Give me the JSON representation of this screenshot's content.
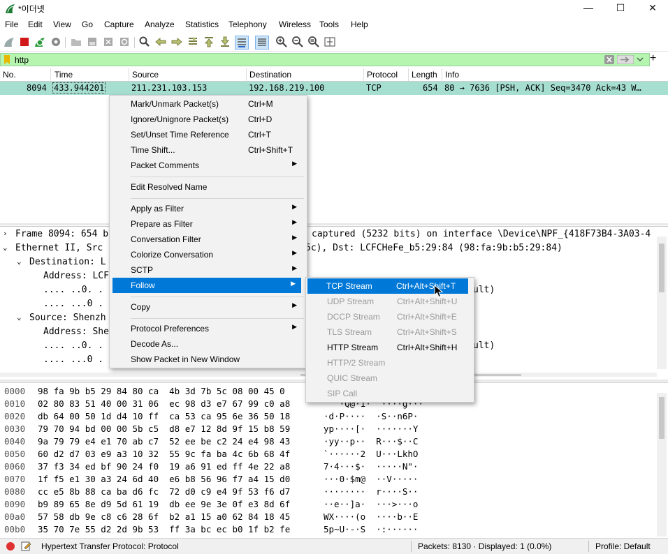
{
  "window": {
    "title": "*이더넷",
    "min_glyph": "—",
    "max_glyph": "☐",
    "close_glyph": "✕"
  },
  "menubar": [
    "File",
    "Edit",
    "View",
    "Go",
    "Capture",
    "Analyze",
    "Statistics",
    "Telephony",
    "Wireless",
    "Tools",
    "Help"
  ],
  "filter": {
    "value": "http"
  },
  "columns": [
    "No.",
    "Time",
    "Source",
    "Destination",
    "Protocol",
    "Length",
    "Info"
  ],
  "packet": {
    "no": "8094",
    "time": "433.944201",
    "source": "211.231.103.153",
    "destination": "192.168.219.100",
    "protocol": "TCP",
    "length": "654",
    "info": "80 → 7636 [PSH, ACK] Seq=3470 Ack=43 W…"
  },
  "details": {
    "frame": "Frame 8094: 654 b",
    "frame_right": "captured (5232 bits) on interface \\Device\\NPF_{418F73B4-3A03-4",
    "eth": "Ethernet II, Src",
    "eth_right": "5c), Dst: LCFCHeFe_b5:29:84 (98:fa:9b:b5:29:84)",
    "dst": "Destination: L",
    "dst_addr": "Address: LCF",
    "bit1": ".... ..0. .",
    "bit1_right": "ult)",
    "bit2": ".... ...0 .",
    "src": "Source: Shenzh",
    "src_addr": "Address: She",
    "bit3": ".... ..0. .",
    "bit3_right": "ult)",
    "bit4": ".... ...0 ."
  },
  "hex_rows": [
    {
      "off": "0000",
      "hex": "98 fa 9b b5 29 84 80 ca  4b 3d 7b 5c 08 00 45 0",
      "asc": ""
    },
    {
      "off": "0010",
      "hex": "02 80 83 51 40 00 31 06  ec 98 d3 e7 67 99 c0 a8",
      "asc": "   ·Q@·1·  ····g···"
    },
    {
      "off": "0020",
      "hex": "db 64 00 50 1d d4 10 ff  ca 53 ca 95 6e 36 50 18",
      "asc": "·d·P····  ·S··n6P·"
    },
    {
      "off": "0030",
      "hex": "79 70 94 bd 00 00 5b c5  d8 e7 12 8d 9f 15 b8 59",
      "asc": "yp····[·  ·······Y"
    },
    {
      "off": "0040",
      "hex": "9a 79 79 e4 e1 70 ab c7  52 ee be c2 24 e4 98 43",
      "asc": "·yy··p··  R···$··C"
    },
    {
      "off": "0050",
      "hex": "60 d2 d7 03 e9 a3 10 32  55 9c fa ba 4c 6b 68 4f",
      "asc": "`······2  U···LkhO"
    },
    {
      "off": "0060",
      "hex": "37 f3 34 ed bf 90 24 f0  19 a6 91 ed ff 4e 22 a8",
      "asc": "7·4···$·  ·····N\"·"
    },
    {
      "off": "0070",
      "hex": "1f f5 e1 30 a3 24 6d 40  e6 b8 56 96 f7 a4 15 d0",
      "asc": "···0·$m@  ··V·····"
    },
    {
      "off": "0080",
      "hex": "cc e5 8b 88 ca ba d6 fc  72 d0 c9 e4 9f 53 f6 d7",
      "asc": "········  r····S··"
    },
    {
      "off": "0090",
      "hex": "b9 89 65 8e d9 5d 61 19  db ee 9e 3e 0f e3 8d 6f",
      "asc": "··e··]a·  ···>···o"
    },
    {
      "off": "00a0",
      "hex": "57 58 db 9e c8 c6 28 6f  b2 a1 15 a0 62 84 18 45",
      "asc": "WX····(o  ····b··E"
    },
    {
      "off": "00b0",
      "hex": "35 70 7e 55 d2 2d 9b 53  ff 3a bc ec b0 1f b2 fe",
      "asc": "5p~U·-·S  ·:······"
    }
  ],
  "context_menu": [
    {
      "label": "Mark/Unmark Packet(s)",
      "shortcut": "Ctrl+M"
    },
    {
      "label": "Ignore/Unignore Packet(s)",
      "shortcut": "Ctrl+D"
    },
    {
      "label": "Set/Unset Time Reference",
      "shortcut": "Ctrl+T"
    },
    {
      "label": "Time Shift...",
      "shortcut": "Ctrl+Shift+T"
    },
    {
      "label": "Packet Comments",
      "shortcut": ""
    },
    {
      "label": "Edit Resolved Name",
      "shortcut": ""
    },
    {
      "label": "Apply as Filter",
      "shortcut": ""
    },
    {
      "label": "Prepare as Filter",
      "shortcut": ""
    },
    {
      "label": "Conversation Filter",
      "shortcut": ""
    },
    {
      "label": "Colorize Conversation",
      "shortcut": ""
    },
    {
      "label": "SCTP",
      "shortcut": ""
    },
    {
      "label": "Follow",
      "shortcut": ""
    },
    {
      "label": "Copy",
      "shortcut": ""
    },
    {
      "label": "Protocol Preferences",
      "shortcut": ""
    },
    {
      "label": "Decode As...",
      "shortcut": ""
    },
    {
      "label": "Show Packet in New Window",
      "shortcut": ""
    }
  ],
  "follow_submenu": [
    {
      "label": "TCP Stream",
      "shortcut": "Ctrl+Alt+Shift+T"
    },
    {
      "label": "UDP Stream",
      "shortcut": "Ctrl+Alt+Shift+U"
    },
    {
      "label": "DCCP Stream",
      "shortcut": "Ctrl+Alt+Shift+E"
    },
    {
      "label": "TLS Stream",
      "shortcut": "Ctrl+Alt+Shift+S"
    },
    {
      "label": "HTTP Stream",
      "shortcut": "Ctrl+Alt+Shift+H"
    },
    {
      "label": "HTTP/2 Stream",
      "shortcut": ""
    },
    {
      "label": "QUIC Stream",
      "shortcut": ""
    },
    {
      "label": "SIP Call",
      "shortcut": ""
    }
  ],
  "statusbar": {
    "protocol": "Hypertext Transfer Protocol: Protocol",
    "packets": "Packets: 8130 · Displayed: 1 (0.0%)",
    "profile": "Profile: Default"
  },
  "colors": {
    "filter_bg": "#b5f5b0",
    "selected_row": "#a6dfcf",
    "highlight": "#0078d7",
    "menu_bg": "#f2f2f2"
  }
}
